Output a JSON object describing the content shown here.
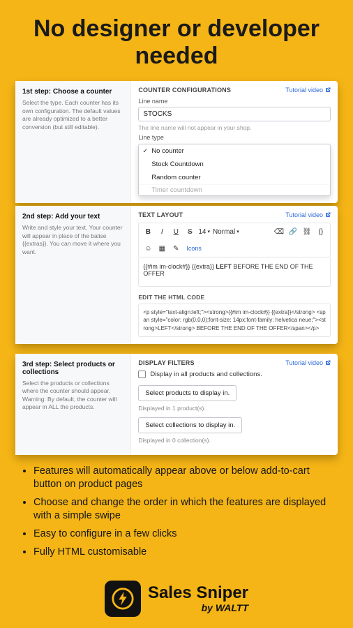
{
  "headline": "No designer or developer needed",
  "tutorial_label": "Tutorial video",
  "step1": {
    "title": "1st step: Choose a counter",
    "desc": "Select the type. Each counter has its own configuration. The default values are already optimized to a better conversion (but still editable).",
    "section": "COUNTER CONFIGURATIONS",
    "line_name_label": "Line name",
    "line_name_value": "STOCKS",
    "line_name_hint": "The line name will not appear in your shop.",
    "line_type_label": "Line type",
    "options": [
      "No counter",
      "Stock Countdown",
      "Random counter",
      "Timer countdown"
    ],
    "selected_index": 0
  },
  "step2": {
    "title": "2nd step: Add your text",
    "desc": "Write and style your text. Your counter will appear in place of the balise {{extras}}. You can move it where you want.",
    "section": "TEXT LAYOUT",
    "font_size": "14",
    "format": "Normal",
    "icons_label": "Icons",
    "editor_content": "{{#im im-clock#}} {{extra}} LEFT BEFORE THE END OF THE OFFER",
    "html_label": "EDIT THE HTML CODE",
    "html_code": "<p style=\"text-align:left;\"><strong>{{#im im-clock#}} {{extra}}</strong> <span style=\"color: rgb(0,0,0);font-size: 14px;font-family: helvetica neue;\"><strong>LEFT</strong> BEFORE THE END OF THE OFFER</span></p>"
  },
  "step3": {
    "title": "3rd step: Select products or collections",
    "desc": "Select the products or collections where the counter should appear. Warning: By default, the counter will appear in ALL the products.",
    "section": "DISPLAY FILTERS",
    "checkbox_label": "Display in all products and collections.",
    "btn_products": "Select products to display in.",
    "products_count": "Displayed in 1 product(s).",
    "btn_collections": "Select collections to display in.",
    "collections_count": "Displayed in 0 collection(s)."
  },
  "bullets": [
    "Features will automatically appear above or below add-to-cart button on product pages",
    "Choose and change the order in which the features are displayed with a simple swipe",
    "Easy to configure in a few clicks",
    "Fully HTML customisable"
  ],
  "brand": {
    "name": "Sales Sniper",
    "by": "by WALTT"
  }
}
